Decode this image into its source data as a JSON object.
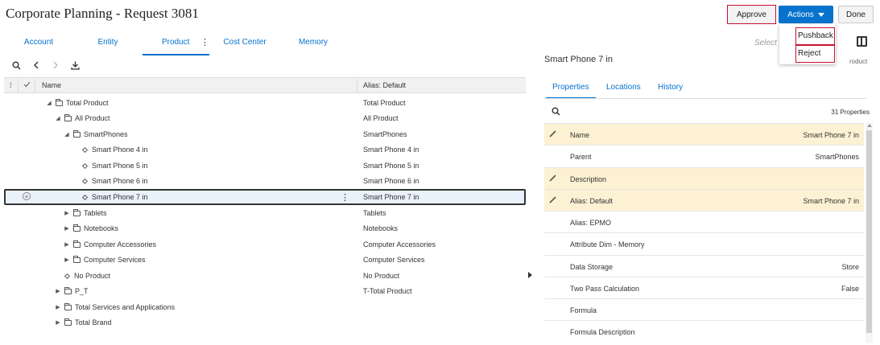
{
  "header": {
    "title": "Corporate Planning - Request 3081",
    "approve_label": "Approve",
    "actions_label": "Actions",
    "done_label": "Done"
  },
  "actions_menu": {
    "items": [
      {
        "label": "Pushback"
      },
      {
        "label": "Reject"
      }
    ]
  },
  "tabs": [
    {
      "label": "Account"
    },
    {
      "label": "Entity"
    },
    {
      "label": "Product"
    },
    {
      "label": "Cost Center"
    },
    {
      "label": "Memory"
    }
  ],
  "toolbar": {
    "icons": [
      "search-icon",
      "back-icon",
      "forward-icon",
      "download-icon"
    ]
  },
  "grid": {
    "columns": {
      "name": "Name",
      "alias": "Alias: Default"
    },
    "rows": [
      {
        "name": "Total Product",
        "alias": "Total Product",
        "type": "folder",
        "expanded": true
      },
      {
        "name": "All Product",
        "alias": "All Product",
        "type": "folder",
        "expanded": true
      },
      {
        "name": "SmartPhones",
        "alias": "SmartPhones",
        "type": "folder",
        "expanded": true
      },
      {
        "name": "Smart Phone 4 in",
        "alias": "Smart Phone 4 in",
        "type": "leaf"
      },
      {
        "name": "Smart Phone 5 in",
        "alias": "Smart Phone 5 in",
        "type": "leaf"
      },
      {
        "name": "Smart Phone 6 in",
        "alias": "Smart Phone 6 in",
        "type": "leaf"
      },
      {
        "name": "Smart Phone 7 in",
        "alias": "Smart Phone 7 in",
        "type": "leaf",
        "selected": true
      },
      {
        "name": "Tablets",
        "alias": "Tablets",
        "type": "folder",
        "expanded": false
      },
      {
        "name": "Notebooks",
        "alias": "Notebooks",
        "type": "folder",
        "expanded": false
      },
      {
        "name": "Computer Accessories",
        "alias": "Computer Accessories",
        "type": "folder",
        "expanded": false
      },
      {
        "name": "Computer Services",
        "alias": "Computer Services",
        "type": "folder",
        "expanded": false
      },
      {
        "name": "No Product",
        "alias": "No Product",
        "type": "leaf"
      },
      {
        "name": "P_T",
        "alias": "T-Total Product",
        "type": "folder",
        "expanded": false
      },
      {
        "name": "Total Services and Applications",
        "alias": "",
        "type": "folder",
        "expanded": false
      },
      {
        "name": "Total Brand",
        "alias": "",
        "type": "folder",
        "expanded": false
      }
    ]
  },
  "details": {
    "title": "Smart Phone 7 in",
    "select_hint": "Select",
    "product_fragment": "roduct",
    "tabs": [
      {
        "label": "Properties"
      },
      {
        "label": "Locations"
      },
      {
        "label": "History"
      }
    ],
    "property_count": "31 Properties",
    "properties": [
      {
        "label": "Name",
        "value": "Smart Phone 7 in",
        "editable": true
      },
      {
        "label": "Parent",
        "value": "SmartPhones",
        "editable": false
      },
      {
        "label": "Description",
        "value": "",
        "editable": true
      },
      {
        "label": "Alias: Default",
        "value": "Smart Phone 7 in",
        "editable": true
      },
      {
        "label": "Alias: EPMO",
        "value": "",
        "editable": false
      },
      {
        "label": "Attribute Dim - Memory",
        "value": "",
        "editable": false
      },
      {
        "label": "Data Storage",
        "value": "Store",
        "editable": false
      },
      {
        "label": "Two Pass Calculation",
        "value": "False",
        "editable": false
      },
      {
        "label": "Formula",
        "value": "",
        "editable": false
      },
      {
        "label": "Formula Description",
        "value": "",
        "editable": false
      }
    ]
  },
  "colors": {
    "accent": "#0572ce",
    "highlight_row": "#fcf1d3",
    "selected_row": "#e9f2fa",
    "callout_border": "#c8102e"
  }
}
